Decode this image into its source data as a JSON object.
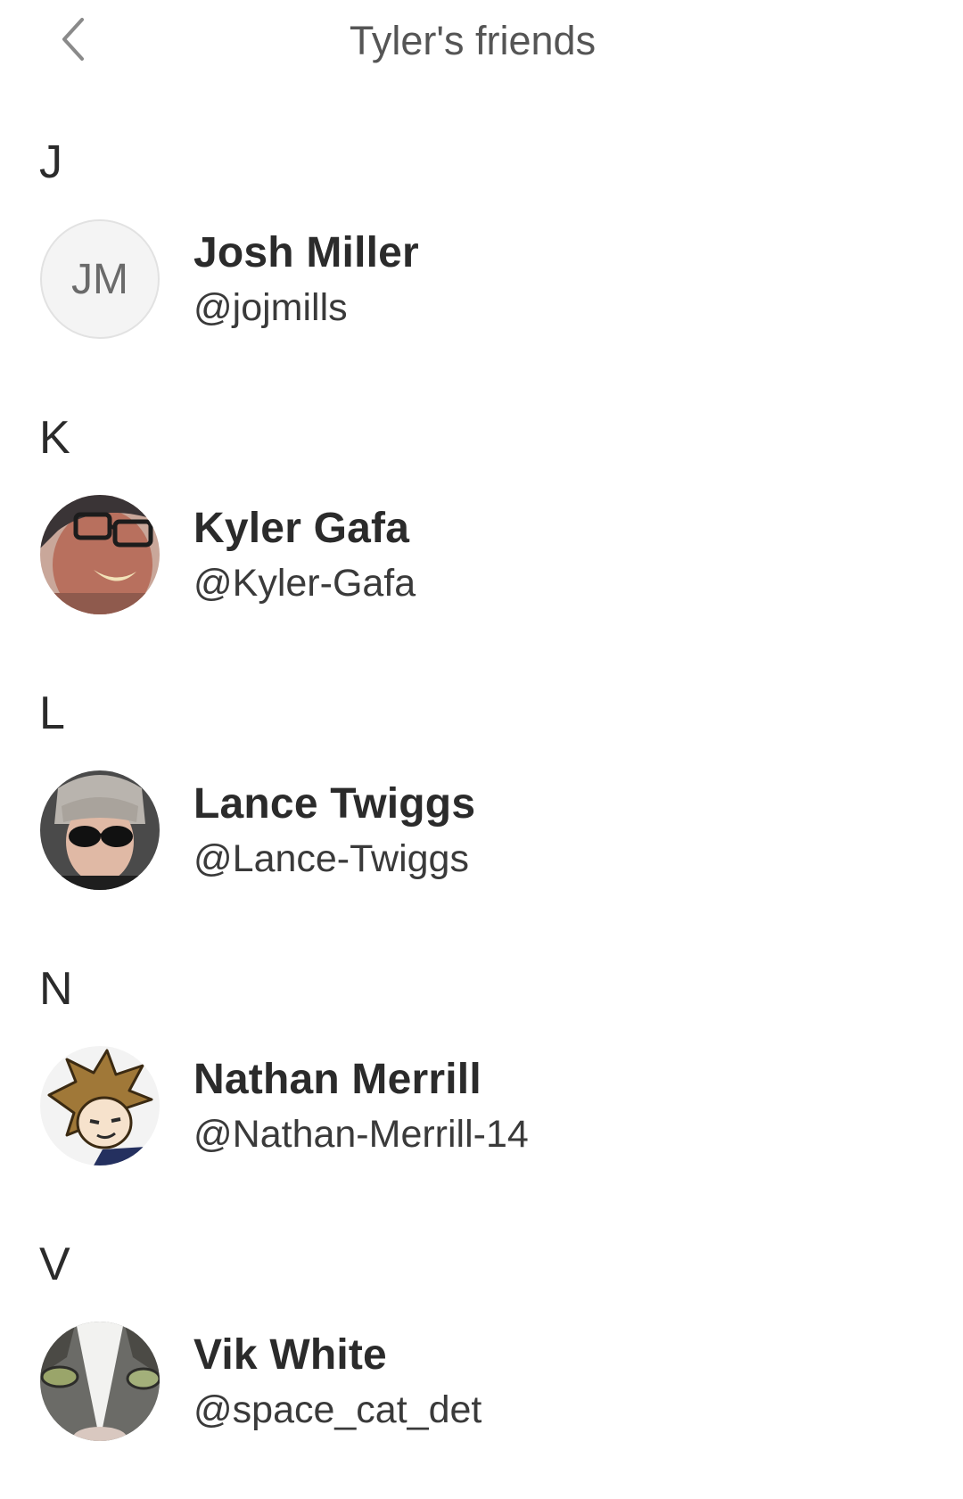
{
  "header": {
    "title": "Tyler's friends",
    "back_icon": "chevron-left-icon"
  },
  "sections": [
    {
      "letter": "J",
      "friend": {
        "name": "Josh Miller",
        "handle": "@jojmills",
        "avatar_initials": "JM",
        "avatar_type": "initials"
      }
    },
    {
      "letter": "K",
      "friend": {
        "name": "Kyler Gafa",
        "handle": "@Kyler-Gafa",
        "avatar_type": "photo"
      }
    },
    {
      "letter": "L",
      "friend": {
        "name": "Lance Twiggs",
        "handle": "@Lance-Twiggs",
        "avatar_type": "photo"
      }
    },
    {
      "letter": "N",
      "friend": {
        "name": "Nathan Merrill",
        "handle": "@Nathan-Merrill-14",
        "avatar_type": "illustration"
      }
    },
    {
      "letter": "V",
      "friend": {
        "name": "Vik White",
        "handle": "@space_cat_det",
        "avatar_type": "photo"
      }
    }
  ],
  "colors": {
    "background": "#ffffff",
    "text_primary": "#2b2b2b",
    "text_title": "#555555",
    "icon": "#8a8a8a",
    "avatar_placeholder": "#f4f4f4"
  }
}
